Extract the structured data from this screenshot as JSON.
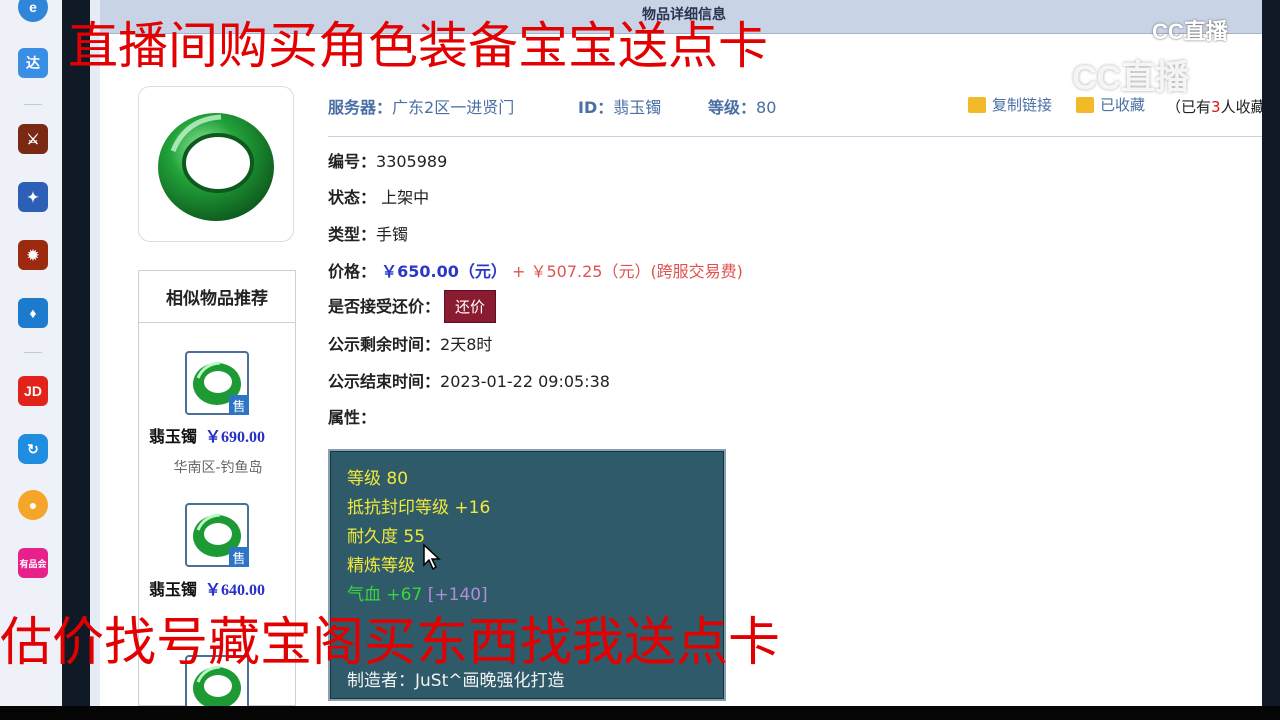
{
  "page": {
    "top_title": "物品详细信息"
  },
  "item": {
    "server_label": "服务器：",
    "server": "广东2区一进贤门",
    "id_label": "ID：",
    "id": "翡玉镯",
    "level_label": "等级：",
    "level": "80",
    "copy_link": "复制链接",
    "favorited": "已收藏",
    "fav_note_prefix": "（已有",
    "fav_count": "3",
    "fav_note_suffix": "人收藏）",
    "number_label": "编号：",
    "number": "3305989",
    "status_label": "状态：",
    "status": "上架中",
    "type_label": "类型：",
    "type": "手镯",
    "price_label": "价格：",
    "price": "￥650.00（元）",
    "price_plus": "+",
    "fee": "￥507.25（元）(跨服交易费)",
    "counter_label": "是否接受还价：",
    "counter_button": "还价",
    "remaining_label": "公示剩余时间：",
    "remaining": "2天8时",
    "end_label": "公示结束时间：",
    "end_time": "2023-01-22 09:05:38",
    "attr_label": "属性："
  },
  "attributes": {
    "line1": "等级 80",
    "line2": "抵抗封印等级 +16",
    "line3": "耐久度 55",
    "line4": "精炼等级 ",
    "line5_main": "气血 +67 ",
    "line5_bonus": "[+140]",
    "line8": "制造者：JuSt^画晚强化打造"
  },
  "similar": {
    "title": "相似物品推荐",
    "badge": "售",
    "items": [
      {
        "name": "翡玉镯",
        "price": "￥690.00",
        "server": "华南区-钓鱼岛"
      },
      {
        "name": "翡玉镯",
        "price": "￥640.00",
        "server": ""
      }
    ]
  },
  "taskbar": {
    "da_label": "达",
    "jd_label": "JD",
    "shop_label": "有品会"
  },
  "overlay": {
    "top_text": "直播间购买角色装备宝宝送点卡",
    "bottom_text": "估价找号藏宝阁买东西找我送点卡",
    "watermark_small": "CC直播",
    "watermark_large": "CC直播"
  },
  "colors": {
    "price_blue": "#2a37c7",
    "price_red": "#e0524f",
    "counter_button": "#8a1c31",
    "attr_bg": "#2f5a6a",
    "attr_yellow": "#f1e93a",
    "attr_green": "#37d63a",
    "overlay_red": "#e30000"
  }
}
